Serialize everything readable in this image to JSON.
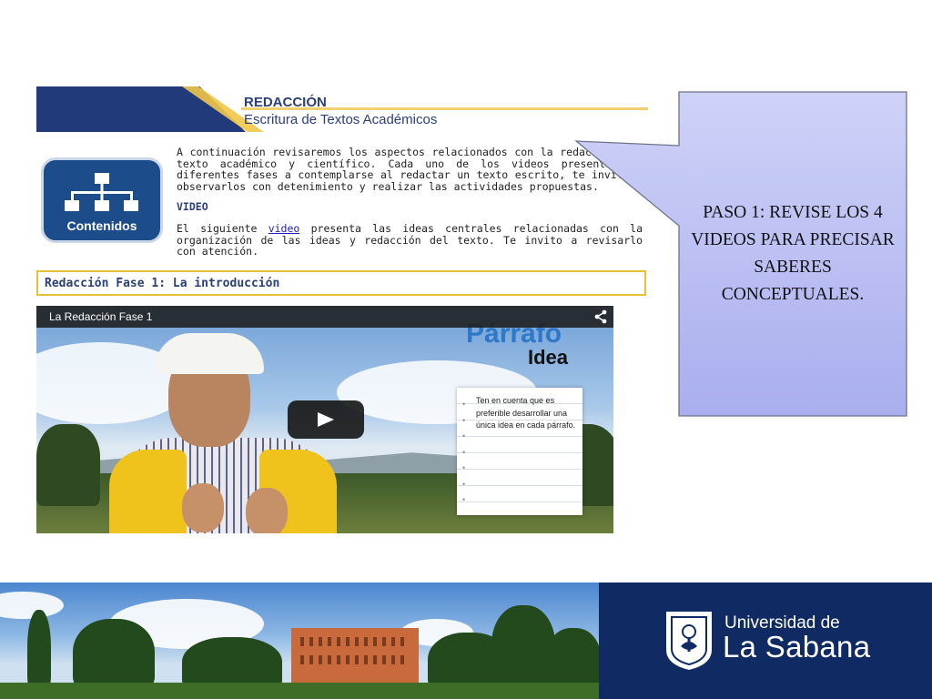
{
  "banner": {
    "title": "REDACCIÓN",
    "subtitle": "Escritura de Textos Académicos"
  },
  "contents_icon": {
    "label": "Contenidos",
    "icon": "sitemap-icon"
  },
  "intro_text": "A continuación revisaremos los aspectos relacionados con la redacción del texto académico y científico. Cada uno de los videos presenta las diferentes fases a contemplarse al redactar un texto escrito, te invito a observarlos con detenimiento y realizar las actividades propuestas.",
  "video_section": {
    "heading": "VIDEO",
    "text_before_link": "El siguiente ",
    "link_text": "video",
    "text_after_link": " presenta las ideas centrales relacionadas con la organización de las ideas y redacción del texto. Te invito a revisarlo con atención."
  },
  "section_title": "Redacción Fase 1: La introducción",
  "player": {
    "title": "La Redacción Fase 1",
    "overlay_word1": "Párrafo",
    "overlay_word2": "Idea",
    "note_text": "Ten en cuenta que es preferible desarrollar una única idea en cada párrafo.",
    "icons": {
      "share": "share-icon",
      "play": "play-icon"
    }
  },
  "callout": {
    "text": "PASO 1: REVISE LOS 4 VIDEOS PARA PRECISAR SABERES CONCEPTUALES.",
    "fill": "#b4b9ef"
  },
  "footer": {
    "university_line1": "Universidad de",
    "university_line2": "La Sabana",
    "seal_icon": "university-seal-icon",
    "brand_color": "#102b63"
  }
}
